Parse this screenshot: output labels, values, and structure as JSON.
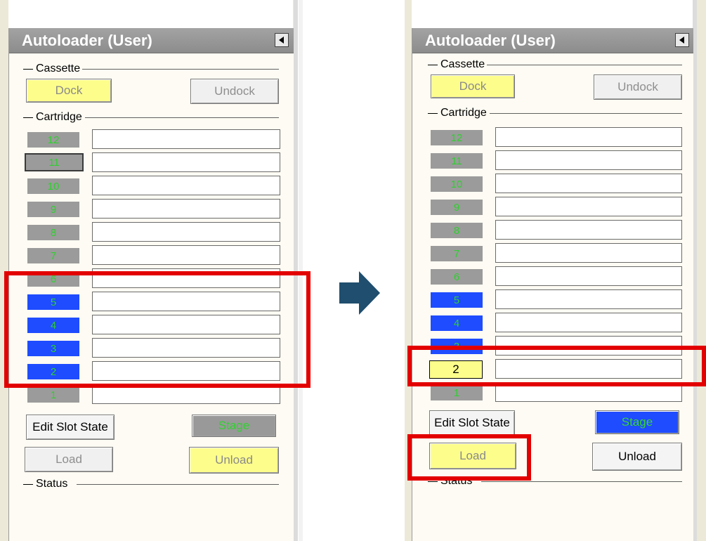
{
  "left": {
    "title": "Autoloader (User)",
    "cassette": {
      "label": "Cassette",
      "dock": "Dock",
      "undock": "Undock"
    },
    "cartridge_label": "Cartridge",
    "slots": [
      "12",
      "11",
      "10",
      "9",
      "8",
      "7",
      "6",
      "5",
      "4",
      "3",
      "2",
      "1"
    ],
    "edit": "Edit Slot State",
    "stage": "Stage",
    "load": "Load",
    "unload": "Unload",
    "status": "Status"
  },
  "right": {
    "title": "Autoloader (User)",
    "cassette": {
      "label": "Cassette",
      "dock": "Dock",
      "undock": "Undock"
    },
    "cartridge_label": "Cartridge",
    "slots": [
      "12",
      "11",
      "10",
      "9",
      "8",
      "7",
      "6",
      "5",
      "4",
      "3",
      "2",
      "1"
    ],
    "edit": "Edit Slot State",
    "stage": "Stage",
    "load": "Load",
    "unload": "Unload",
    "status": "Status"
  },
  "colors": {
    "highlight": "#e30000",
    "arrow": "#1f4e6e",
    "slot_blue": "#1f4cff",
    "button_yellow": "#fdfd8c"
  }
}
